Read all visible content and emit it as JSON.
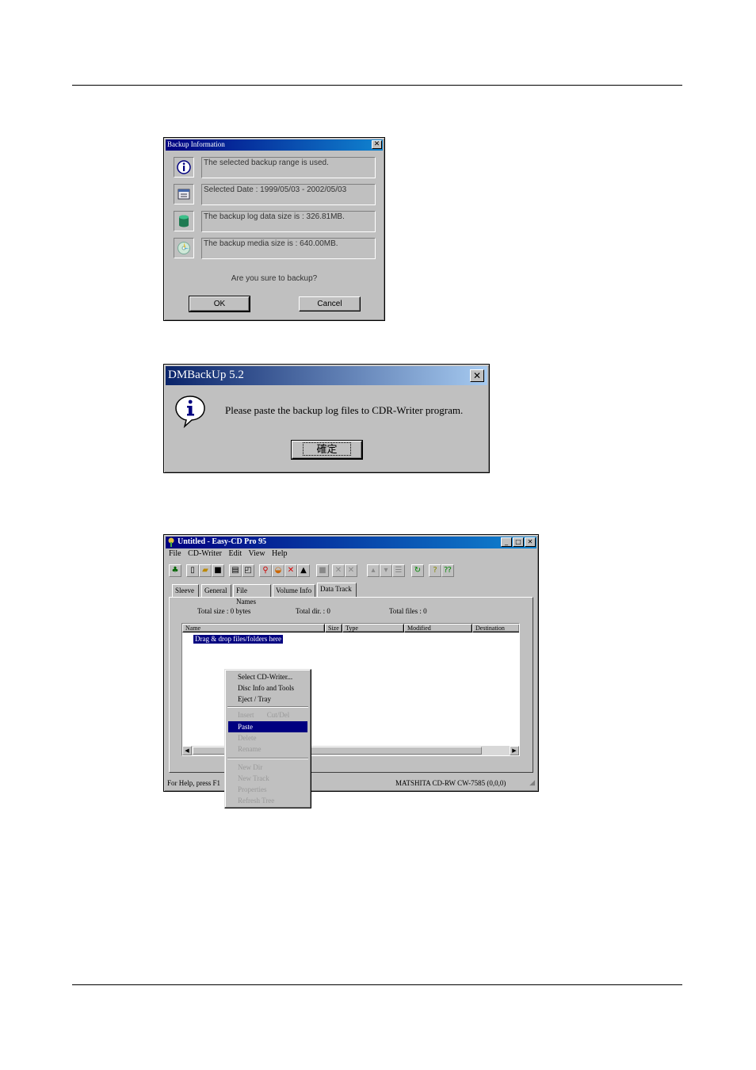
{
  "backup_info": {
    "title": "Backup Information",
    "rows": [
      {
        "icon": "info-icon",
        "text": "The selected backup range is used."
      },
      {
        "icon": "calendar-icon",
        "text": "Selected Date : 1999/05/03 - 2002/05/03"
      },
      {
        "icon": "database-icon",
        "text": "The backup log data size is : 326.81MB."
      },
      {
        "icon": "cd-media-icon",
        "text": "The backup media size is : 640.00MB."
      }
    ],
    "question": "Are you sure to backup?",
    "ok_label": "OK",
    "cancel_label": "Cancel"
  },
  "dmbackup": {
    "title": "DMBackUp 5.2",
    "message": "Please paste the backup log files to CDR-Writer program.",
    "ok_label": "確定"
  },
  "easycd": {
    "title": "Untitled - Easy-CD Pro 95",
    "menu": [
      "File",
      "CD-Writer",
      "Edit",
      "View",
      "Help"
    ],
    "tabs": [
      "Sleeve",
      "General",
      "File Names",
      "Volume Info",
      "Data Track"
    ],
    "active_tab": "Data Track",
    "total_size": "Total size : 0 bytes",
    "total_dir": "Total dir. : 0",
    "total_files": "Total files : 0",
    "columns": [
      "Name",
      "Size",
      "Type",
      "Modified",
      "Destination"
    ],
    "drop_hint": "Drag & drop files/folders here",
    "status_left": "For Help, press F1",
    "status_right": "MATSHITA CD-RW CW-7585 (0,0,0)",
    "context_menu": {
      "group1": [
        "Select CD-Writer...",
        "Disc Info and Tools",
        "Eject / Tray"
      ],
      "group2_row": [
        "Insert",
        "Cut/Del"
      ],
      "group2": [
        "Paste",
        "Delete",
        "Rename"
      ],
      "group3": [
        "New Dir",
        "New Track",
        "Properties",
        "Refresh Tree"
      ],
      "selected": "Paste"
    }
  }
}
